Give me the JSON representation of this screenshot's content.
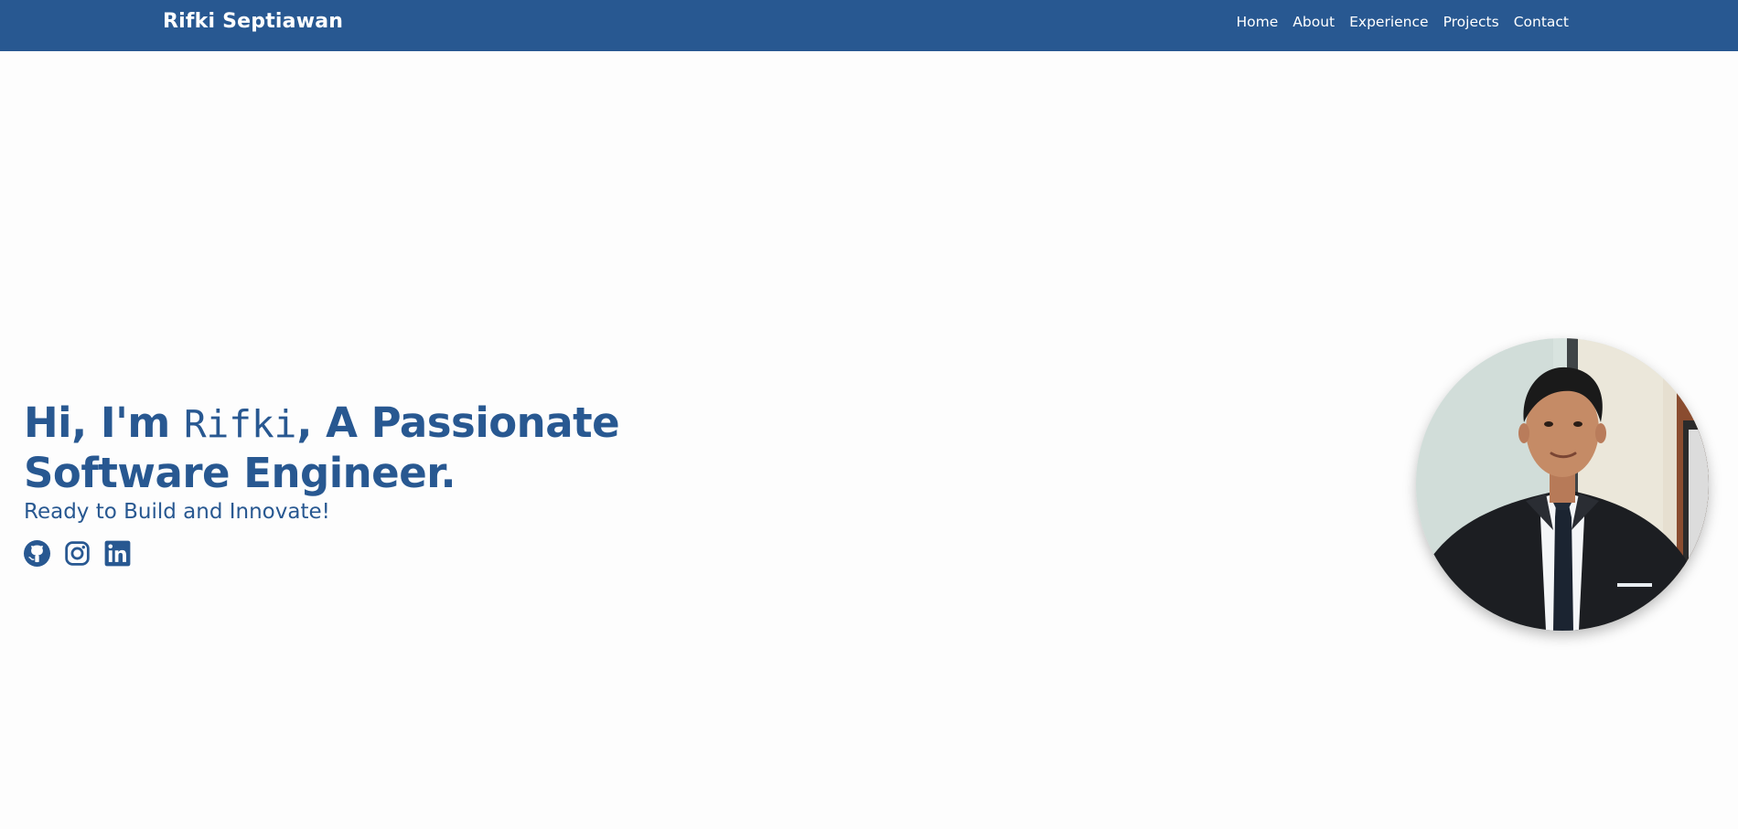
{
  "brand": "Rifki Septiawan",
  "nav": {
    "items": [
      {
        "label": "Home"
      },
      {
        "label": "About"
      },
      {
        "label": "Experience"
      },
      {
        "label": "Projects"
      },
      {
        "label": "Contact"
      }
    ]
  },
  "hero": {
    "greeting_prefix": "Hi, I'm ",
    "name": "Rifki",
    "greeting_suffix": ", A Passionate Software Engineer.",
    "subtitle": "Ready to Build and Innovate!"
  },
  "socials": [
    {
      "icon": "github-icon"
    },
    {
      "icon": "instagram-icon"
    },
    {
      "icon": "linkedin-icon"
    }
  ],
  "colors": {
    "primary": "#285891",
    "background": "#fdfdfd",
    "nav_text": "#ffffff"
  }
}
